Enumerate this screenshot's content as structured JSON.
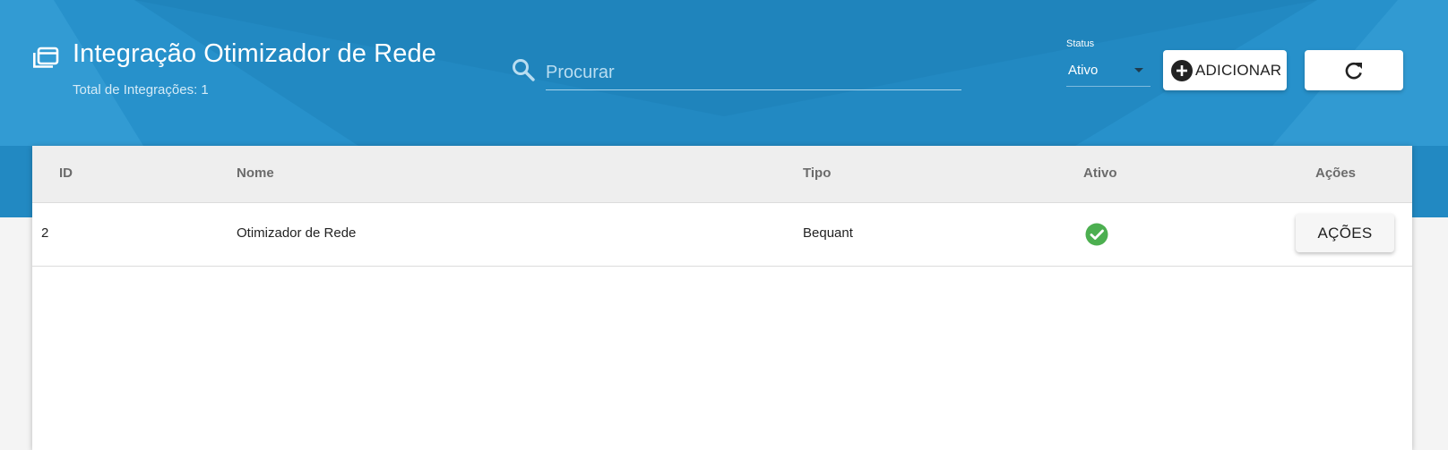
{
  "colors": {
    "header_bg": "#2289c2",
    "header_shade_dark": "#1b7bb3",
    "header_shade_light": "#3aa2d8",
    "success": "#4caf50",
    "page_bg": "#f4f4f4"
  },
  "header": {
    "icon": "list-window-icon",
    "title": "Integração Otimizador de Rede",
    "subtitle": "Total de Integrações: 1"
  },
  "search": {
    "icon": "search-icon",
    "placeholder": "Procurar",
    "value": ""
  },
  "status_filter": {
    "label": "Status",
    "selected": "Ativo"
  },
  "toolbar": {
    "add_icon": "plus-circle-icon",
    "add_label": "ADICIONAR",
    "refresh_icon": "refresh-icon"
  },
  "table": {
    "columns": [
      "ID",
      "Nome",
      "Tipo",
      "Ativo",
      "Ações"
    ],
    "rows": [
      {
        "id": "2",
        "nome": "Otimizador de Rede",
        "tipo": "Bequant",
        "ativo_icon": "check-circle-icon",
        "actions_label": "AÇÕES"
      }
    ]
  }
}
